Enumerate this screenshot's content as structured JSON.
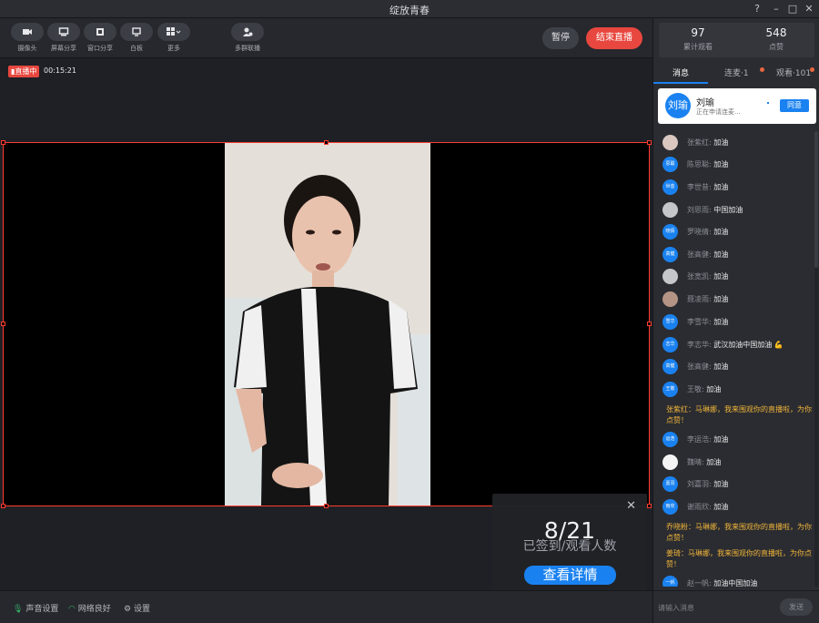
{
  "window": {
    "title": "绽放青春",
    "controls": [
      "?",
      "–",
      "□",
      "✕"
    ]
  },
  "toolbar": {
    "tools": [
      {
        "label": "摄像头",
        "icon": "camera-icon"
      },
      {
        "label": "屏幕分享",
        "icon": "screen-share-icon"
      },
      {
        "label": "窗口分享",
        "icon": "window-share-icon"
      },
      {
        "label": "白板",
        "icon": "whiteboard-icon"
      },
      {
        "label": "更多",
        "icon": "grid-icon"
      },
      {
        "label": "多群联播",
        "icon": "multi-group-icon"
      }
    ],
    "pause_label": "暂停",
    "end_label": "结束直播"
  },
  "stage": {
    "live_label": "直播中",
    "live_time": "00:15:21"
  },
  "signin_card": {
    "count": "8/21",
    "subtitle": "已签到/观看人数",
    "detail_label": "查看详情"
  },
  "statusbar": {
    "audio_label": "声音设置",
    "network_label": "网络良好",
    "settings_label": "设置"
  },
  "stats": [
    {
      "value": "97",
      "caption": "累计观看"
    },
    {
      "value": "548",
      "caption": "点赞"
    }
  ],
  "tabs": [
    {
      "label": "消息"
    },
    {
      "label": "连麦·1"
    },
    {
      "label": "观看·101"
    }
  ],
  "request": {
    "avatar_text": "刘瑜",
    "name": "刘瑜",
    "status": "正在申请连麦...",
    "agree_label": "同意"
  },
  "messages": [
    {
      "avatar": "",
      "type": "photo",
      "name": "张紫红:",
      "content": "加油"
    },
    {
      "avatar": "思聪",
      "type": "text",
      "name": "陈思聪:",
      "content": "加油"
    },
    {
      "avatar": "世昔",
      "type": "text",
      "name": "李世昔:",
      "content": "加油"
    },
    {
      "avatar": "",
      "type": "photo2",
      "name": "刘思雨:",
      "content": "中国加油"
    },
    {
      "avatar": "晓倩",
      "type": "text",
      "name": "罗晓倩:",
      "content": "加油"
    },
    {
      "avatar": "高健",
      "type": "text",
      "name": "张高健:",
      "content": "加油"
    },
    {
      "avatar": "",
      "type": "photo2",
      "name": "张宽凯:",
      "content": "加油"
    },
    {
      "avatar": "",
      "type": "photo3",
      "name": "聂凌雨:",
      "content": "加油"
    },
    {
      "avatar": "雪华",
      "type": "text",
      "name": "李雪华:",
      "content": "加油"
    },
    {
      "avatar": "志华",
      "type": "text",
      "name": "李志华:",
      "content": "武汉加油中国加油 💪"
    },
    {
      "avatar": "高健",
      "type": "text",
      "name": "张高健:",
      "content": "加油"
    },
    {
      "avatar": "王敬",
      "type": "text",
      "name": "王敬:",
      "content": "加油"
    }
  ],
  "system_msgs": [
    "张紫红：马琳娜，我来围观你的直播啦，为你点赞！",
    "乔晓粉：马琳娜，我来围观你的直播啦，为你点赞！",
    "姜琦：马琳娜，我来围观你的直播啦，为你点赞！"
  ],
  "messages2": [
    {
      "avatar": "运浩",
      "type": "text",
      "name": "李运浩:",
      "content": "加油"
    },
    {
      "avatar": "",
      "type": "panda",
      "name": "魏晴:",
      "content": "加油"
    },
    {
      "avatar": "嘉羽",
      "type": "text",
      "name": "刘嘉羽:",
      "content": "加油"
    },
    {
      "avatar": "雨欣",
      "type": "text",
      "name": "谢雨欣:",
      "content": "加油"
    }
  ],
  "last_msg": {
    "avatar": "一帆",
    "name": "赵一帆:",
    "content": "加油中国加油"
  },
  "input": {
    "placeholder": "请输入消息",
    "send_label": "发送"
  }
}
